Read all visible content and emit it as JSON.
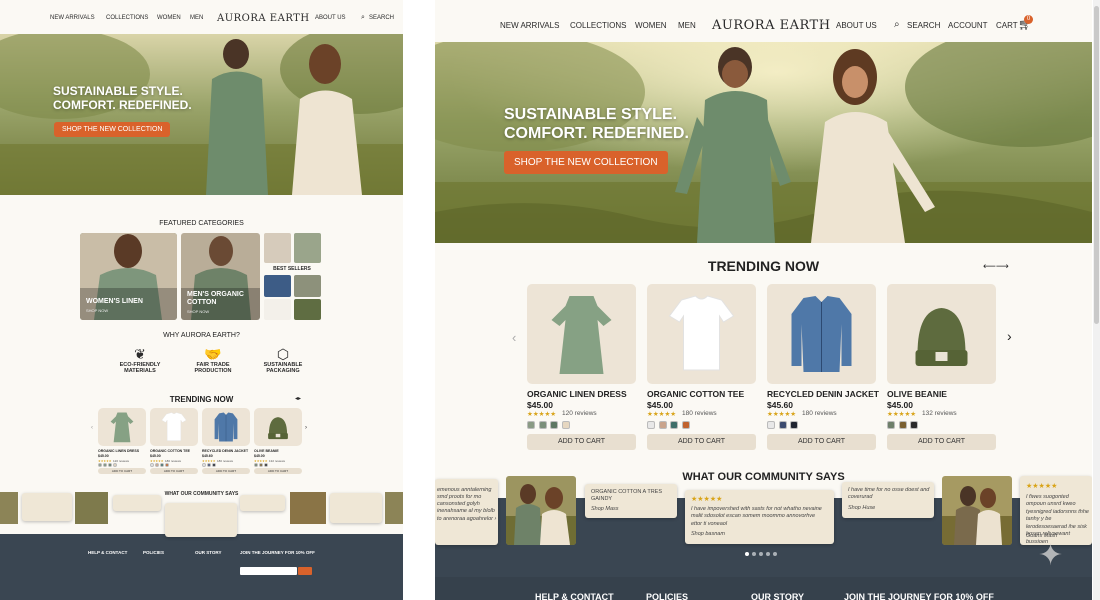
{
  "brand": "AURORA EARTH",
  "nav": {
    "new_arrivals": "NEW ARRIVALS",
    "collections": "COLLECTIONS",
    "women": "WOMEN",
    "men": "MEN",
    "about": "ABOUT US",
    "search": "SEARCH",
    "account": "ACCOUNT",
    "cart": "CART",
    "cart_count": "0"
  },
  "hero": {
    "line1": "SUSTAINABLE STYLE.",
    "line2": "COMFORT. REDEFINED.",
    "cta": "SHOP THE NEW COLLECTION"
  },
  "featured": {
    "title": "FEATURED CATEGORIES",
    "women_linen": "WOMEN'S LINEN",
    "women_sub": "SHOP NOW",
    "mens_cotton_1": "MEN'S ORGANIC",
    "mens_cotton_2": "COTTON",
    "mens_sub": "SHOP NOW",
    "best_sellers": "BEST SELLERS"
  },
  "why": {
    "title": "WHY AURORA EARTH?",
    "items": [
      {
        "l1": "ECO-FRIENDLY",
        "l2": "MATERIALS"
      },
      {
        "l1": "FAIR TRADE",
        "l2": "PRODUCTION"
      },
      {
        "l1": "SUSTAINABLE",
        "l2": "PACKAGING"
      }
    ]
  },
  "trending": {
    "title": "TRENDING NOW",
    "products": [
      {
        "name": "ORGANIC LINEN DRESS",
        "price": "$45.00",
        "stars": "★★★★★",
        "reviews": "120 reviews",
        "swatches": [
          "#8a9a84",
          "#7b8f7a",
          "#5d7762",
          "#e6d7c0"
        ]
      },
      {
        "name": "ORGANIC COTTON TEE",
        "price": "$45.00",
        "stars": "★★★★★",
        "reviews": "180 reviews",
        "swatches": [
          "#e8e8e8",
          "#c9a48c",
          "#3f6f6a",
          "#c0622e"
        ]
      },
      {
        "name": "RECYCLED DENIN JACKET",
        "price": "$45.60",
        "stars": "★★★★★",
        "reviews": "180 reviews",
        "swatches": [
          "#e8e8e8",
          "#3c4b6e",
          "#1f2430"
        ]
      },
      {
        "name": "OLIVE BEANIE",
        "price": "$45.00",
        "stars": "★★★★★",
        "reviews": "132 reviews",
        "swatches": [
          "#6e7f6a",
          "#7a6030",
          "#2a2a2a"
        ]
      }
    ],
    "add_to_cart": "ADD TO CART"
  },
  "community": {
    "title": "WHAT OUR COMMUNITY SAYS",
    "quote_a_title": "ORGANIC COTTON A TRES",
    "quote_a_sub": "GAINDY",
    "quote_a_name": "Shop Mass",
    "quote_b": "I have impovershed with sasts for not whatho nevaine malit sdosolot escan somem moommo annovorhve ettor ti voneaol",
    "quote_b_name": "Shop basnam",
    "quote_c": "I have time for no osse doest and coverurad",
    "quote_c_name": "Shop Huse",
    "quote_d": "I fiwes suogonted ompoun unsrd kweo tyesnigred iadorsnns thhe tanhy y be lerodesoesaerad ihe sisk bosen relivsewant bussioen",
    "quote_d_name": "Goans Mash",
    "quote_e": "emenous anntalerning smd proots for mo cansonsted golyh inenahsame al my blolb to arenoraa agoahrelor ›",
    "stars": "★★★★★"
  },
  "footer": {
    "help": "HELP & CONTACT",
    "policies": "POLICIES",
    "story": "OUR STORY",
    "join": "JOIN THE JOURNEY FOR 10% OFF"
  },
  "colors": {
    "accent": "#d9622b",
    "dark": "#3a4652",
    "beige": "#efe7d6",
    "gold": "#d9a419"
  }
}
